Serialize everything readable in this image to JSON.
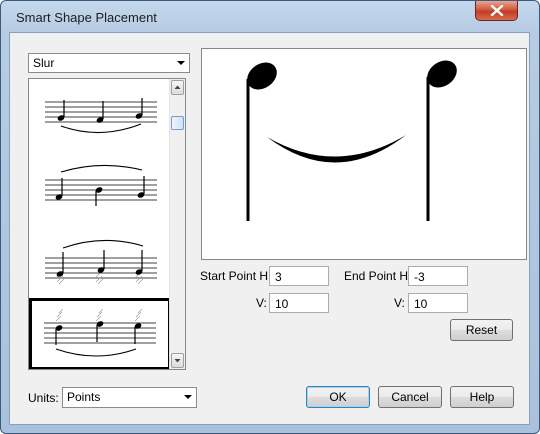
{
  "window": {
    "title": "Smart Shape Placement",
    "close_icon": "close-x-icon",
    "close_color": "#c13b24"
  },
  "shape_select": {
    "value": "Slur"
  },
  "thumbnails": [
    {
      "name": "slur-below-tips"
    },
    {
      "name": "slur-above-tips"
    },
    {
      "name": "slur-above-tips-with-hatch"
    },
    {
      "name": "slur-below-tips-with-hatch",
      "selected": true
    }
  ],
  "fields": {
    "start_h_label": "Start Point H:",
    "start_h_value": "3",
    "start_v_label": "V:",
    "start_v_value": "10",
    "end_h_label": "End Point H:",
    "end_h_value": "-3",
    "end_v_label": "V:",
    "end_v_value": "10"
  },
  "buttons": {
    "reset": "Reset",
    "ok": "OK",
    "cancel": "Cancel",
    "help": "Help"
  },
  "units": {
    "label": "Units:",
    "value": "Points"
  }
}
